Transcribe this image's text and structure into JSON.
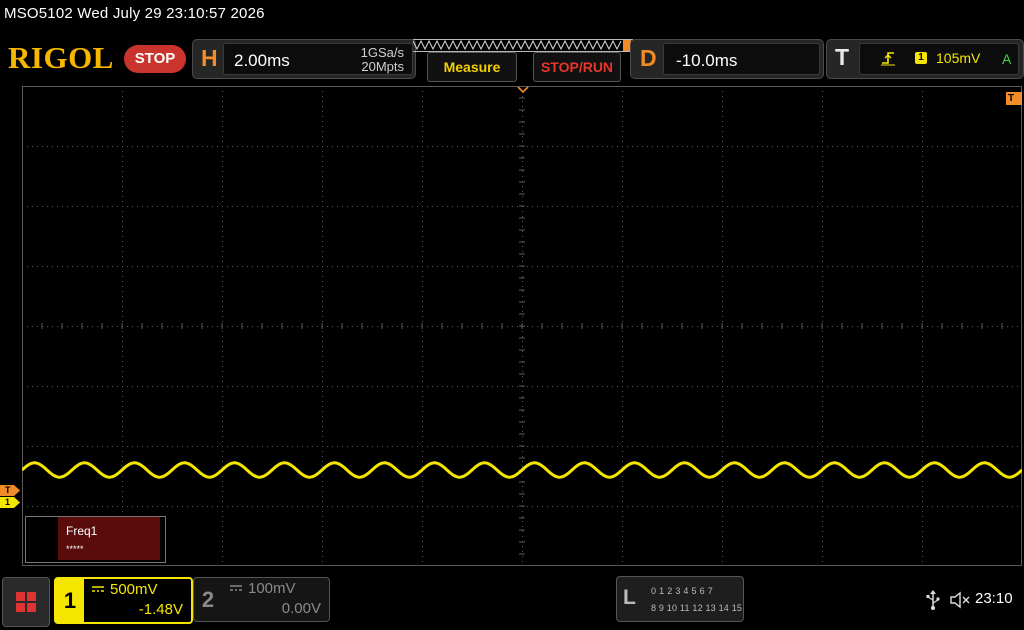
{
  "title_bar": {
    "text": "MSO5102  Wed July 29 23:10:57 2026"
  },
  "header": {
    "logo": "RIGOL",
    "run_status": "STOP",
    "horizontal": {
      "letter": "H",
      "timebase": "2.00ms",
      "sample_rate": "1GSa/s",
      "memory_depth": "20Mpts"
    },
    "measure_label": "Measure",
    "stop_run_label": "STOP/RUN",
    "delay": {
      "letter": "D",
      "offset": "-10.0ms"
    },
    "trigger": {
      "letter": "T",
      "source": "1",
      "level": "105mV",
      "mode": "A",
      "edge_icon": "rising-edge-icon"
    }
  },
  "markers": {
    "trigger_position": "trigger-position-arrow",
    "right_marker": "T",
    "trigger_level": "T",
    "ch1_ground": "1"
  },
  "waveform": {
    "channel": "1",
    "color": "#f5e600",
    "shape": "sine",
    "cycles_on_screen": 20,
    "center_div_from_top": 6.4,
    "amplitude_div": 0.12
  },
  "measurement": {
    "label": "Freq1",
    "value": "*****"
  },
  "channels": [
    {
      "number": "1",
      "scale": "500mV",
      "offset": "-1.48V",
      "active": true,
      "color": "#f5e600"
    },
    {
      "number": "2",
      "scale": "100mV",
      "offset": "0.00V",
      "active": false,
      "color": "#8a8a8a"
    }
  ],
  "logic_analyzer": {
    "letter": "L",
    "row1": "0 1 2 3   4 5 6 7",
    "row2": "8  9 10 11  12 13 14 15"
  },
  "status": {
    "usb_icon": "usb-icon",
    "sound_icon": "speaker-muted-icon",
    "time": "23:10"
  },
  "colors": {
    "accent_orange": "#f28c28",
    "stop_red": "#c9342d",
    "ch1_yellow": "#f5e600",
    "grid": "#5a5a5a"
  }
}
